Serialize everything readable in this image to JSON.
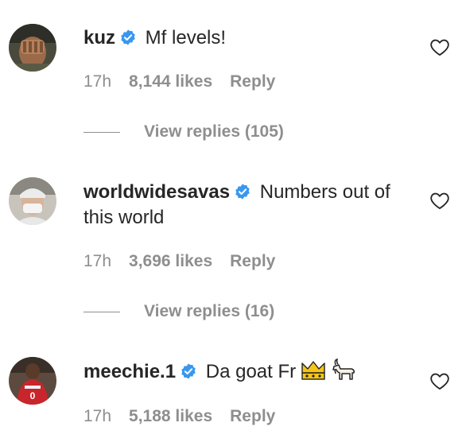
{
  "comments": [
    {
      "username": "kuz",
      "verified": true,
      "text": "Mf levels!",
      "time": "17h",
      "likes": "8,144 likes",
      "reply_label": "Reply",
      "view_replies": "View replies (105)"
    },
    {
      "username": "worldwidesavas",
      "verified": true,
      "text": "Numbers out of this world",
      "time": "17h",
      "likes": "3,696 likes",
      "reply_label": "Reply",
      "view_replies": "View replies (16)"
    },
    {
      "username": "meechie.1",
      "verified": true,
      "text": "Da goat Fr",
      "emojis": [
        "crown-emoji",
        "goat-emoji"
      ],
      "time": "17h",
      "likes": "5,188 likes",
      "reply_label": "Reply"
    }
  ],
  "colors": {
    "text": "#262626",
    "muted": "#8e8e8e",
    "verified": "#3897f0",
    "background": "#ffffff"
  },
  "icons": {
    "verified": "verified-badge-icon",
    "like": "heart-outline-icon"
  }
}
